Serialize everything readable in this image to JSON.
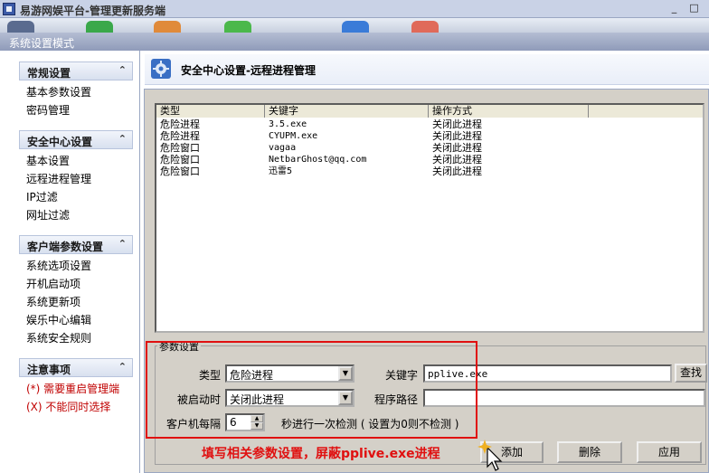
{
  "window": {
    "title": "易游网娱平台-管理更新服务端",
    "minimize": "_",
    "maximize": "□"
  },
  "mode_bar": {
    "title": "系统设置模式"
  },
  "sidebar": {
    "groups": [
      {
        "title": "常规设置",
        "items": [
          "基本参数设置",
          "密码管理"
        ]
      },
      {
        "title": "安全中心设置",
        "items": [
          "基本设置",
          "远程进程管理",
          "IP过滤",
          "网址过滤"
        ]
      },
      {
        "title": "客户端参数设置",
        "items": [
          "系统选项设置",
          "开机启动项",
          "系统更新项",
          "娱乐中心编辑",
          "系统安全规则"
        ]
      },
      {
        "title": "注意事项",
        "items": [
          "(*) 需要重启管理端",
          "(X) 不能同时选择"
        ]
      }
    ]
  },
  "main": {
    "title": "安全中心设置-远程进程管理",
    "table": {
      "columns": [
        "类型",
        "关键字",
        "操作方式"
      ],
      "rows": [
        [
          "危险进程",
          "3.5.exe",
          "关闭此进程"
        ],
        [
          "危险进程",
          "CYUPM.exe",
          "关闭此进程"
        ],
        [
          "危险窗口",
          "vagaa",
          "关闭此进程"
        ],
        [
          "危险窗口",
          "NetbarGhost@qq.com",
          "关闭此进程"
        ],
        [
          "危险窗口",
          "迅雷5",
          "关闭此进程"
        ]
      ]
    },
    "params": {
      "legend": "参数设置",
      "type_label": "类型",
      "type_value": "危险进程",
      "keyword_label": "关键字",
      "keyword_value": "pplive.exe",
      "search_button": "查找",
      "action_label": "被启动时",
      "action_value": "关闭此进程",
      "path_label": "程序路径",
      "path_value": "",
      "interval_label": "客户机每隔",
      "interval_value": "6",
      "interval_suffix": "秒进行一次检测 ( 设置为0则不检测 )"
    },
    "buttons": {
      "add": "添加",
      "delete": "删除",
      "apply": "应用"
    }
  },
  "annotation": {
    "text": "填写相关参数设置，屏蔽pplive.exe进程",
    "color": "#e01010"
  }
}
